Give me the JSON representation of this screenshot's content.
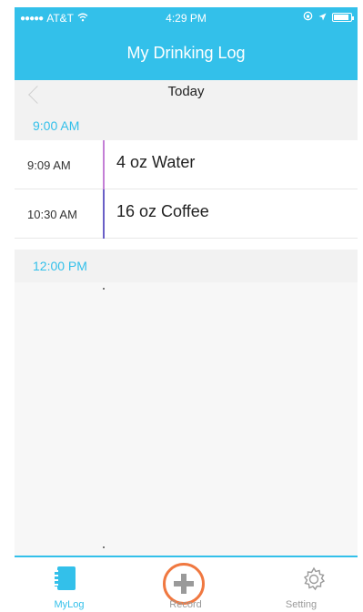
{
  "status_bar": {
    "carrier": "AT&T",
    "time": "4:29 PM"
  },
  "header": {
    "title": "My Drinking Log"
  },
  "day_nav": {
    "label": "Today"
  },
  "sections": [
    {
      "time": "9:00 AM",
      "entries": [
        {
          "time": "9:09 AM",
          "description": "4 oz Water",
          "color": "#c47fd6"
        },
        {
          "time": "10:30 AM",
          "description": "16 oz Coffee",
          "color": "#6a5fc7"
        }
      ]
    },
    {
      "time": "12:00 PM",
      "entries": []
    }
  ],
  "tabs": [
    {
      "label": "MyLog",
      "icon": "notebook-icon",
      "active": true
    },
    {
      "label": "Record",
      "icon": "plus-icon",
      "active": false
    },
    {
      "label": "Setting",
      "icon": "gear-icon",
      "active": false
    }
  ],
  "colors": {
    "accent": "#33c0ea",
    "record_ring": "#f07840"
  }
}
